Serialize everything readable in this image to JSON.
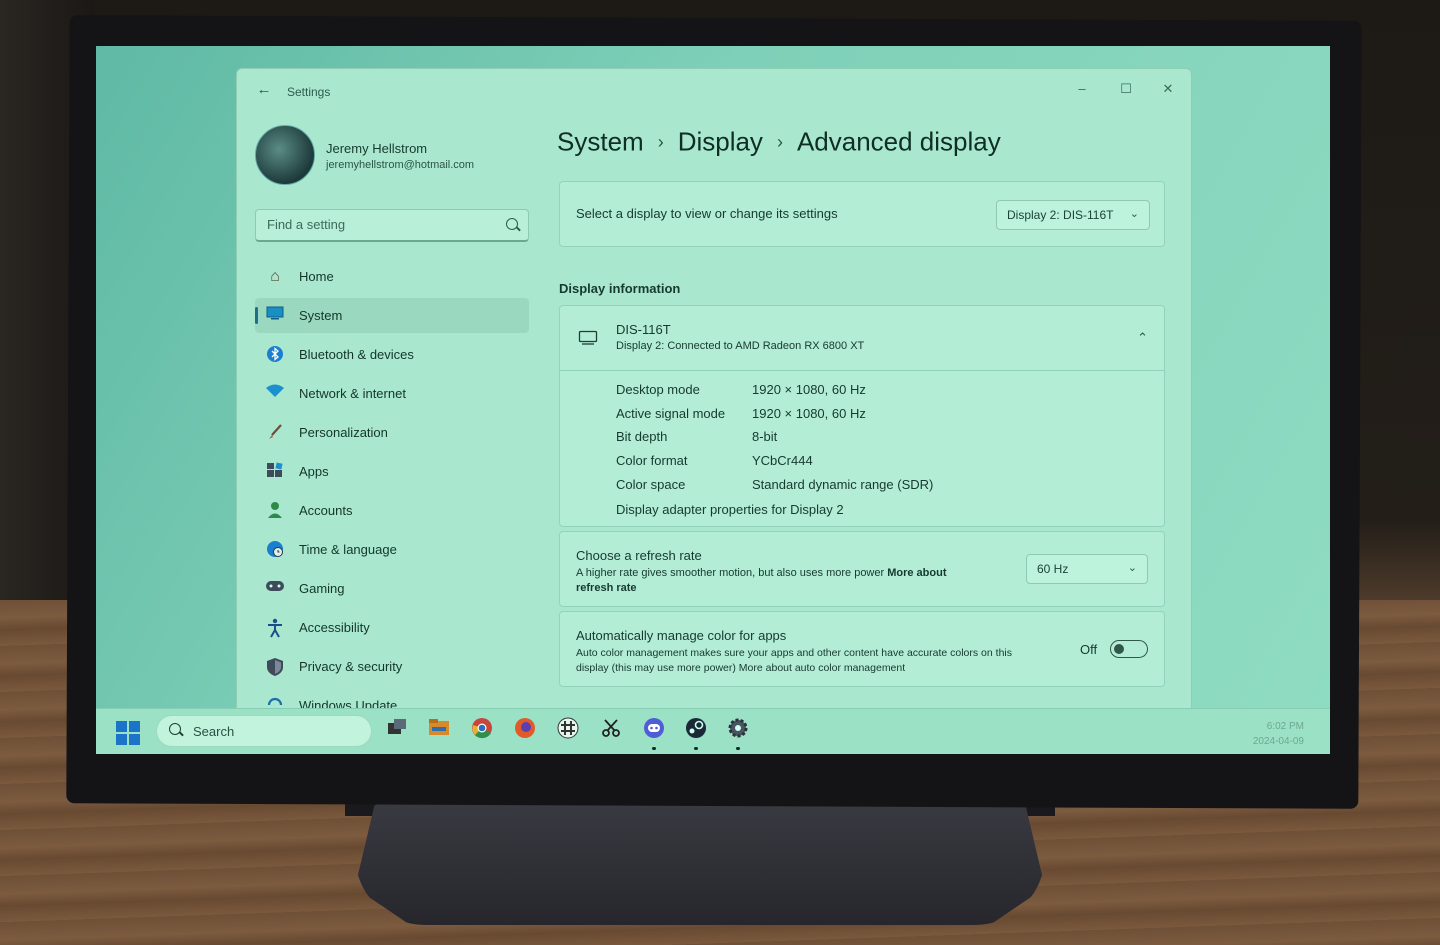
{
  "window": {
    "app_title": "Settings",
    "back_icon": "back-arrow-icon",
    "controls": {
      "minimize": "–",
      "maximize": "☐",
      "close": "✕"
    }
  },
  "profile": {
    "name": "Jeremy Hellstrom",
    "email": "jeremyhellstrom@hotmail.com"
  },
  "search": {
    "placeholder": "Find a setting"
  },
  "nav": {
    "items": [
      {
        "label": "Home",
        "icon": "home-icon"
      },
      {
        "label": "System",
        "icon": "monitor-icon",
        "active": true
      },
      {
        "label": "Bluetooth & devices",
        "icon": "bluetooth-icon"
      },
      {
        "label": "Network & internet",
        "icon": "wifi-icon"
      },
      {
        "label": "Personalization",
        "icon": "brush-icon"
      },
      {
        "label": "Apps",
        "icon": "apps-icon"
      },
      {
        "label": "Accounts",
        "icon": "person-icon"
      },
      {
        "label": "Time & language",
        "icon": "globe-clock-icon"
      },
      {
        "label": "Gaming",
        "icon": "gamepad-icon"
      },
      {
        "label": "Accessibility",
        "icon": "accessibility-icon"
      },
      {
        "label": "Privacy & security",
        "icon": "shield-icon"
      },
      {
        "label": "Windows Update",
        "icon": "update-icon"
      }
    ]
  },
  "breadcrumb": {
    "system": "System",
    "display": "Display",
    "current": "Advanced display",
    "separator": "›"
  },
  "select_display": {
    "label": "Select a display to view or change its settings",
    "value": "Display 2: DIS-116T"
  },
  "display_info": {
    "heading": "Display information",
    "monitor_name": "DIS-116T",
    "connection": "Display 2: Connected to AMD Radeon RX 6800 XT",
    "rows": [
      {
        "label": "Desktop mode",
        "value": "1920 × 1080, 60 Hz"
      },
      {
        "label": "Active signal mode",
        "value": "1920 × 1080, 60 Hz"
      },
      {
        "label": "Bit depth",
        "value": "8-bit"
      },
      {
        "label": "Color format",
        "value": "YCbCr444"
      },
      {
        "label": "Color space",
        "value": "Standard dynamic range (SDR)"
      }
    ],
    "adapter_link": "Display adapter properties for Display 2"
  },
  "refresh_rate": {
    "title": "Choose a refresh rate",
    "description": "A higher rate gives smoother motion, but also uses more power",
    "link_1": "More about",
    "link_2": "refresh rate",
    "value": "60 Hz"
  },
  "color_management": {
    "title": "Automatically manage color for apps",
    "description_1": "Auto color management makes sure your apps and other content have accurate colors on this",
    "description_2": "display (this may use more power) More about auto color management",
    "toggle_state": "Off"
  },
  "taskbar": {
    "search_label": "Search",
    "apps": [
      "task-view-icon",
      "file-explorer-icon",
      "chrome-icon",
      "firefox-icon",
      "slack-icon",
      "snipping-tool-icon",
      "discord-icon",
      "steam-icon",
      "settings-gear-icon"
    ],
    "time": "6:02 PM",
    "date": "2024-04-09"
  },
  "colors": {
    "accent": "#1f6e8a",
    "screen_tint": "#a9e8cf"
  }
}
